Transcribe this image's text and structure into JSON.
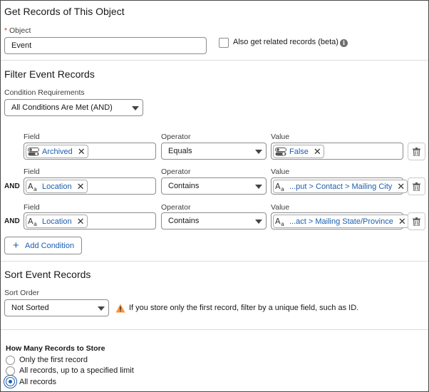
{
  "get_records": {
    "heading": "Get Records of This Object",
    "object_label": "Object",
    "required_marker": "*",
    "object_value": "Event",
    "related_label": "Also get related records (beta)"
  },
  "filter": {
    "heading": "Filter Event Records",
    "condition_requirements_label": "Condition Requirements",
    "condition_requirements_value": "All Conditions Are Met (AND)",
    "field_label": "Field",
    "operator_label": "Operator",
    "value_label": "Value",
    "conditions": [
      {
        "connector": "",
        "field": "Archived",
        "field_icon": "toggle-icon",
        "operator": "Equals",
        "value": "False",
        "value_icon": "toggle-icon"
      },
      {
        "connector": "AND",
        "field": "Location",
        "field_icon": "text-field-icon",
        "operator": "Contains",
        "value": "...put > Contact > Mailing City",
        "value_icon": "text-field-icon"
      },
      {
        "connector": "AND",
        "field": "Location",
        "field_icon": "text-field-icon",
        "operator": "Contains",
        "value": "...act > Mailing State/Province",
        "value_icon": "text-field-icon"
      }
    ],
    "add_condition_label": "Add Condition"
  },
  "sort": {
    "heading": "Sort Event Records",
    "order_label": "Sort Order",
    "order_value": "Not Sorted",
    "warning_text": "If you store only the first record, filter by a unique field, such as ID."
  },
  "store": {
    "heading": "How Many Records to Store",
    "options": [
      "Only the first record",
      "All records, up to a specified limit",
      "All records"
    ],
    "selected_index": 2
  },
  "colors": {
    "accent": "#1b5eae",
    "required": "#c23934",
    "warning": "#fe9339",
    "border": "#8c8c8c",
    "divider": "#dddbda"
  }
}
